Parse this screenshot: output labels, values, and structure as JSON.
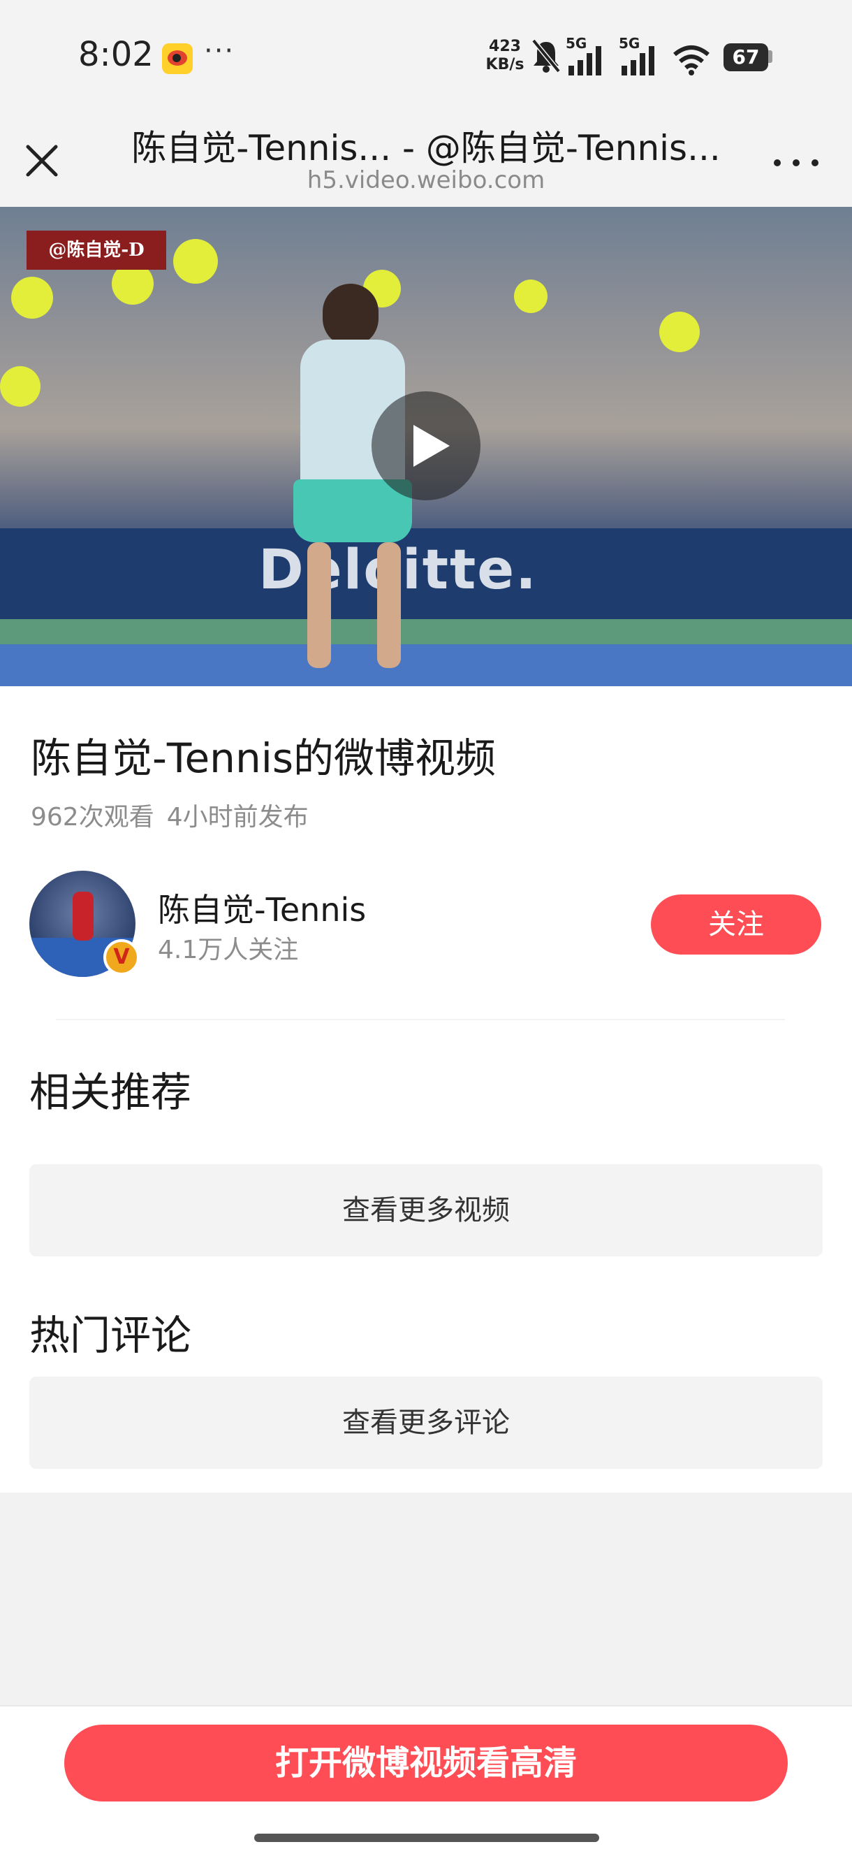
{
  "status_bar": {
    "time": "8:02",
    "more": "···",
    "net_speed_value": "423",
    "net_speed_unit": "KB/s",
    "network_1": "5G",
    "network_2": "5G",
    "battery": "67",
    "icons": [
      "weibo-app-icon",
      "bell-muted-icon",
      "signal-icon",
      "signal-icon",
      "wifi-icon",
      "battery-icon"
    ]
  },
  "header": {
    "title": "陈自觉-Tennis... - @陈自觉-Tennis...",
    "url": "h5.video.weibo.com",
    "close_icon": "close-icon",
    "menu_icon": "more-horizontal-icon"
  },
  "video": {
    "watermark": "@陈自觉-D",
    "banner_text": "Deloitte.",
    "play_icon": "play-icon"
  },
  "info": {
    "title": "陈自觉-Tennis的微博视频",
    "views": "962次观看",
    "published": "4小时前发布"
  },
  "author": {
    "name": "陈自觉-Tennis",
    "followers": "4.1万人关注",
    "verified_badge": "V",
    "follow_label": "关注"
  },
  "sections": {
    "related_title": "相关推荐",
    "related_more": "查看更多视频",
    "comments_title": "热门评论",
    "comments_more": "查看更多评论"
  },
  "bottom": {
    "open_app_label": "打开微博视频看高清"
  },
  "colors": {
    "accent": "#ff4d55",
    "background": "#f2f2f2",
    "muted_text": "#8c8c8c"
  }
}
